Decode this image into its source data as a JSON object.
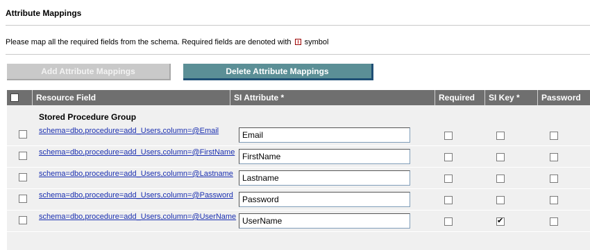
{
  "page": {
    "title": "Attribute Mappings",
    "instruction_prefix": "Please map all the required fields from the schema. Required fields are denoted with",
    "instruction_suffix": "symbol"
  },
  "toolbar": {
    "add_label": "Add Attribute Mappings",
    "delete_label": "Delete Attribute Mappings"
  },
  "table": {
    "columns": [
      "Resource Field",
      "SI Attribute *",
      "Required",
      "SI Key *",
      "Password"
    ],
    "group": "Stored Procedure Group",
    "rows": [
      {
        "resource": "schema=dbo,procedure=add_Users,column=@Email",
        "attribute": "Email",
        "required": false,
        "si_key": false,
        "password": false
      },
      {
        "resource": "schema=dbo,procedure=add_Users,column=@FirstName",
        "attribute": "FirstName",
        "required": false,
        "si_key": false,
        "password": false
      },
      {
        "resource": "schema=dbo,procedure=add_Users,column=@Lastname",
        "attribute": "Lastname",
        "required": false,
        "si_key": false,
        "password": false
      },
      {
        "resource": "schema=dbo,procedure=add_Users,column=@Password",
        "attribute": "Password",
        "required": false,
        "si_key": false,
        "password": false
      },
      {
        "resource": "schema=dbo,procedure=add_Users,column=@UserName",
        "attribute": "UserName",
        "required": false,
        "si_key": true,
        "password": false
      }
    ]
  },
  "colors": {
    "header_bg": "#6f6f6f",
    "delete_button_bg": "#5b8f96",
    "disabled_button_bg": "#c9c9c9",
    "link": "#1a2fb0"
  }
}
